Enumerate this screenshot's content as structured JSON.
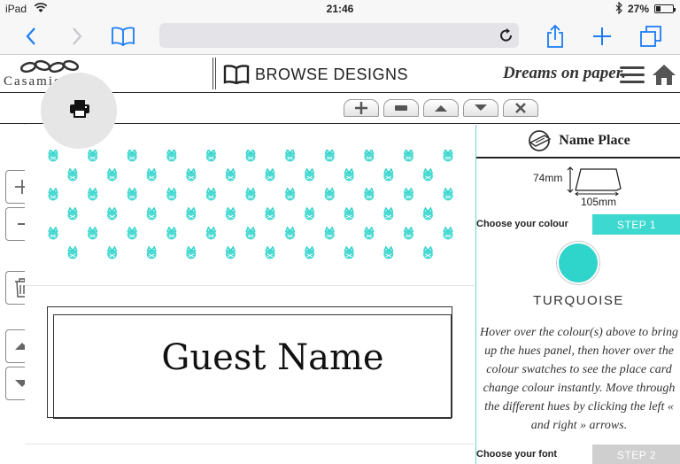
{
  "status_bar": {
    "device": "iPad",
    "time": "21:46",
    "battery": "27%",
    "battery_level": 0.27
  },
  "browser": {
    "address": ""
  },
  "header": {
    "brand": "Casamiento",
    "browse_label": "BROWSE DESIGNS",
    "tagline": "Dreams on paper."
  },
  "editor": {
    "guest_name": "Guest Name"
  },
  "panel": {
    "title": "Name Place",
    "dim_height": "74mm",
    "dim_width": "105mm",
    "step1": {
      "label": "Choose your colour",
      "tab": "STEP 1",
      "color": "#3dd8cf"
    },
    "colour": {
      "name": "TURQUOISE",
      "swatch": "#2fd4cb"
    },
    "instructions": "Hover over the colour(s) above to bring up the hues panel, then hover over the colour swatches to see the place card change colour instantly. Move through the different hues by clicking the left « and right » arrows.",
    "step2": {
      "label": "Choose your font",
      "tab": "STEP 2",
      "color": "#cfcfcf"
    }
  },
  "colors": {
    "accent": "#3dd8cf",
    "ios_blue": "#1a7cf5"
  }
}
